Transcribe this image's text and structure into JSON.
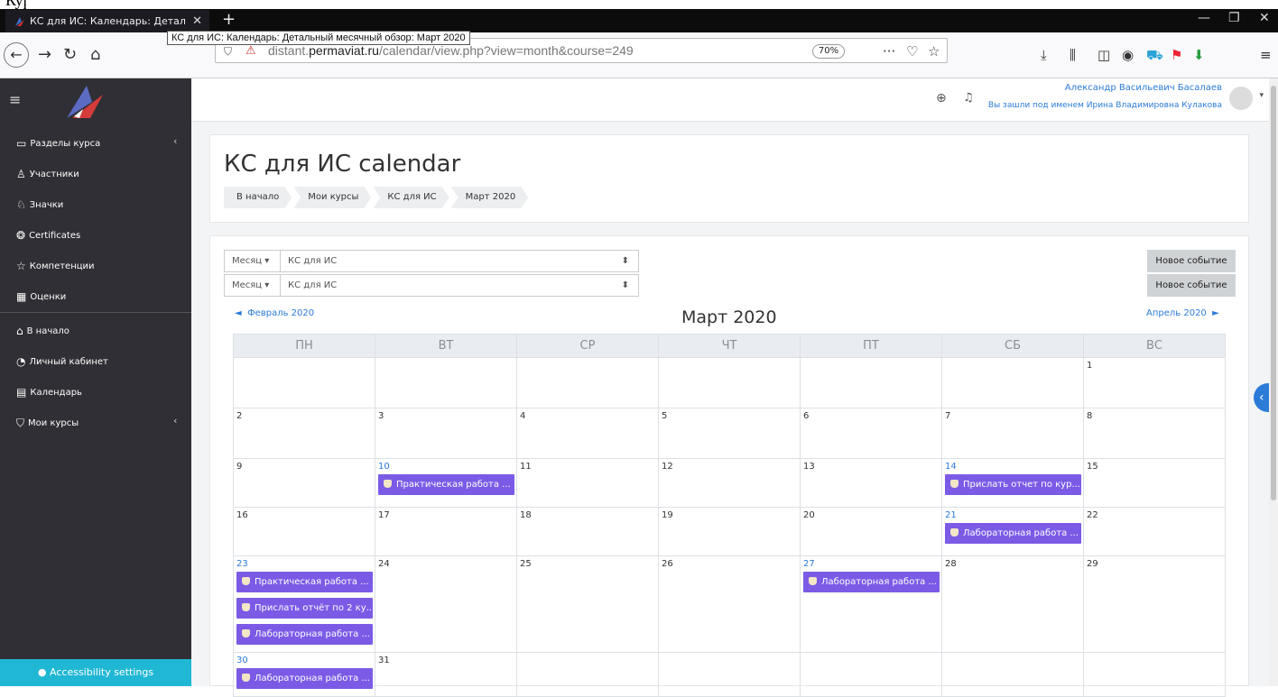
{
  "browser": {
    "tab_title": "КС для ИС: Календарь: Детал",
    "tab_close": "✕",
    "new_tab": "+",
    "tooltip": "КС для ИС: Календарь: Детальный месячный обзор: Март 2020",
    "url_prefix": "distant.",
    "url_domain": "permaviat.ru",
    "url_path": "/calendar/view.php?view=month&course=249",
    "zoom": "70%",
    "more": "···"
  },
  "corner_text": "Кур",
  "header": {
    "user_name": "Александр Васильевич Басалаев",
    "user_sub": "Вы зашли под именем Ирина Владимировна Кулакова"
  },
  "sidebar": {
    "items": [
      {
        "label": "Разделы курса",
        "icon": "folder-icon"
      },
      {
        "label": "Участники",
        "icon": "users-icon"
      },
      {
        "label": "Значки",
        "icon": "badges-icon"
      },
      {
        "label": "Certificates",
        "icon": "certificate-icon"
      },
      {
        "label": "Компетенции",
        "icon": "star-icon"
      },
      {
        "label": "Оценки",
        "icon": "grades-icon"
      },
      {
        "label": "В начало",
        "icon": "home-icon"
      },
      {
        "label": "Личный кабинет",
        "icon": "dashboard-icon"
      },
      {
        "label": "Календарь",
        "icon": "calendar-icon"
      },
      {
        "label": "Мои курсы",
        "icon": "graduation-icon"
      }
    ],
    "accessibility": "Accessibility settings"
  },
  "page": {
    "title": "КС для ИС calendar",
    "breadcrumbs": [
      "В начало",
      "Мои курсы",
      "КС для ИС",
      "Март 2020"
    ]
  },
  "calendar": {
    "view_select": "Месяц",
    "course_select": "КС для ИС",
    "new_event": "Новое событие",
    "prev_month": "Февраль 2020",
    "next_month": "Апрель 2020",
    "month_title": "Март 2020",
    "weekdays": [
      "ПН",
      "ВТ",
      "СР",
      "ЧТ",
      "ПТ",
      "СБ",
      "ВС"
    ],
    "events": {
      "e10": "Практическая работа ...",
      "e14": "Прислать отчет по кур...",
      "e21": "Лабораторная работа ...",
      "e23a": "Практическая работа ...",
      "e23b": "Прислать отчёт по 2 ку...",
      "e23c": "Лабораторная работа ...",
      "e27": "Лабораторная работа ...",
      "e30": "Лабораторная работа ..."
    },
    "days": {
      "d1": "1",
      "d2": "2",
      "d3": "3",
      "d4": "4",
      "d5": "5",
      "d6": "6",
      "d7": "7",
      "d8": "8",
      "d9": "9",
      "d10": "10",
      "d11": "11",
      "d12": "12",
      "d13": "13",
      "d14": "14",
      "d15": "15",
      "d16": "16",
      "d17": "17",
      "d18": "18",
      "d19": "19",
      "d20": "20",
      "d21": "21",
      "d22": "22",
      "d23": "23",
      "d24": "24",
      "d25": "25",
      "d26": "26",
      "d27": "27",
      "d28": "28",
      "d29": "29",
      "d30": "30",
      "d31": "31"
    }
  },
  "colors": {
    "event": "#7b5be6",
    "sidebar": "#2f2f35",
    "link": "#2b7bd8",
    "accessibility": "#1fb7d4"
  }
}
